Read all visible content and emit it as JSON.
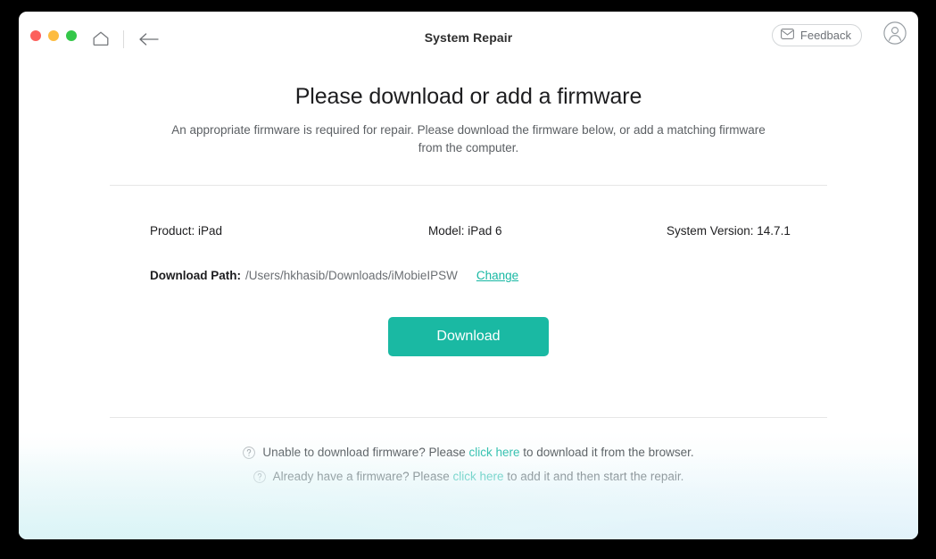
{
  "window": {
    "title": "System Repair",
    "traffic_lights": [
      "close",
      "minimize",
      "zoom"
    ],
    "home_icon": "home-icon",
    "back_icon": "back-arrow-icon",
    "feedback": {
      "label": "Feedback",
      "icon": "envelope-icon"
    },
    "account_icon": "user-avatar-icon"
  },
  "main": {
    "title": "Please download or add a firmware",
    "subtitle": "An appropriate firmware is required for repair. Please download the firmware below, or add a matching firmware from the computer.",
    "info": {
      "product": "Product: iPad",
      "model": "Model: iPad 6",
      "system_version": "System Version: 14.7.1"
    },
    "download_path": {
      "label": "Download Path:",
      "value": "/Users/hkhasib/Downloads/iMobieIPSW",
      "change_label": "Change"
    },
    "download_button": "Download"
  },
  "help": {
    "icon": "question-circle-icon",
    "lines": [
      {
        "prefix": "Unable to download firmware? Please ",
        "link": "click here",
        "suffix": " to download it from the browser."
      },
      {
        "prefix": "Already have a firmware? Please ",
        "link": "click here",
        "suffix": " to add it and then start the repair."
      }
    ]
  },
  "colors": {
    "accent": "#1ab9a3",
    "link": "#17b8a3",
    "text": "#1d1d1f",
    "muted": "#6b6f73",
    "divider": "#e6e6e6",
    "traffic_red": "#fc605c",
    "traffic_yellow": "#fdbc40",
    "traffic_green": "#34c749",
    "backdrop": "#000000"
  }
}
